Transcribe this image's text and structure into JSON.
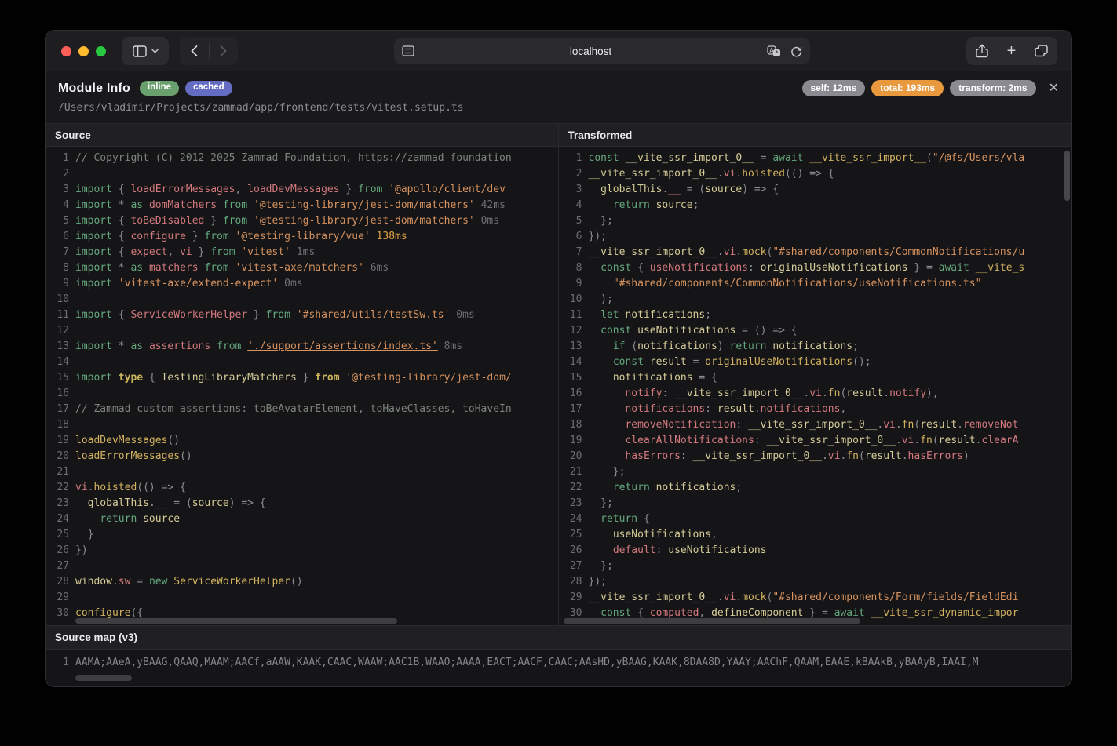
{
  "browser": {
    "url": "localhost",
    "traffic_lights": {
      "close": "#ff5f57",
      "minimize": "#febc2e",
      "zoom": "#28c840"
    }
  },
  "icons": {
    "plus": "+",
    "close": "✕"
  },
  "header": {
    "title": "Module Info",
    "badges": [
      {
        "label": "inline",
        "color": "#6aa06d"
      },
      {
        "label": "cached",
        "color": "#646cc3"
      }
    ],
    "path": "/Users/vladimir/Projects/zammad/app/frontend/tests/vitest.setup.ts",
    "timings": [
      {
        "label": "self: 12ms",
        "color": "#8a8a90"
      },
      {
        "label": "total: 193ms",
        "color": "#e8993e"
      },
      {
        "label": "transform: 2ms",
        "color": "#8a8a90"
      }
    ]
  },
  "syntax_colors": {
    "comment": "#7c847c",
    "keyword": "#64a87e",
    "identifier": "#d3797e",
    "string": "#d6925f",
    "function": "#d2b160",
    "variable": "#d6cc98",
    "punctuation": "#8e8e93",
    "timing": "#6f6f75",
    "timing_slow": "#e0a345"
  },
  "panels": {
    "source": {
      "title": "Source",
      "lines": [
        [
          [
            "c",
            "// Copyright (C) 2012-2025 Zammad Foundation, https://zammad-foundation"
          ]
        ],
        [],
        [
          [
            "k",
            "import "
          ],
          [
            "p",
            "{ "
          ],
          [
            "i",
            "loadErrorMessages"
          ],
          [
            "p",
            ", "
          ],
          [
            "i",
            "loadDevMessages"
          ],
          [
            "p",
            " } "
          ],
          [
            "k",
            "from "
          ],
          [
            "s",
            "'@apollo/client/dev"
          ]
        ],
        [
          [
            "k",
            "import "
          ],
          [
            "p",
            "* "
          ],
          [
            "k",
            "as "
          ],
          [
            "i",
            "domMatchers"
          ],
          [
            "k",
            " from "
          ],
          [
            "s",
            "'@testing-library/jest-dom/matchers'"
          ],
          [
            "t",
            " 42ms"
          ]
        ],
        [
          [
            "k",
            "import "
          ],
          [
            "p",
            "{ "
          ],
          [
            "i",
            "toBeDisabled"
          ],
          [
            "p",
            " } "
          ],
          [
            "k",
            "from "
          ],
          [
            "s",
            "'@testing-library/jest-dom/matchers'"
          ],
          [
            "t",
            " 0ms"
          ]
        ],
        [
          [
            "k",
            "import "
          ],
          [
            "p",
            "{ "
          ],
          [
            "i",
            "configure"
          ],
          [
            "p",
            " } "
          ],
          [
            "k",
            "from "
          ],
          [
            "s",
            "'@testing-library/vue'"
          ],
          [
            "th",
            " 138ms"
          ]
        ],
        [
          [
            "k",
            "import "
          ],
          [
            "p",
            "{ "
          ],
          [
            "i",
            "expect"
          ],
          [
            "p",
            ", "
          ],
          [
            "i",
            "vi"
          ],
          [
            "p",
            " } "
          ],
          [
            "k",
            "from "
          ],
          [
            "s",
            "'vitest'"
          ],
          [
            "t",
            " 1ms"
          ]
        ],
        [
          [
            "k",
            "import "
          ],
          [
            "p",
            "* "
          ],
          [
            "k",
            "as "
          ],
          [
            "i",
            "matchers"
          ],
          [
            "k",
            " from "
          ],
          [
            "s",
            "'vitest-axe/matchers'"
          ],
          [
            "t",
            " 6ms"
          ]
        ],
        [
          [
            "k",
            "import "
          ],
          [
            "s",
            "'vitest-axe/extend-expect'"
          ],
          [
            "t",
            " 0ms"
          ]
        ],
        [],
        [
          [
            "k",
            "import "
          ],
          [
            "p",
            "{ "
          ],
          [
            "i",
            "ServiceWorkerHelper"
          ],
          [
            "p",
            " } "
          ],
          [
            "k",
            "from "
          ],
          [
            "s",
            "'#shared/utils/testSw.ts'"
          ],
          [
            "t",
            " 0ms"
          ]
        ],
        [],
        [
          [
            "k",
            "import "
          ],
          [
            "p",
            "* "
          ],
          [
            "k",
            "as "
          ],
          [
            "i",
            "assertions"
          ],
          [
            "k",
            " from "
          ],
          [
            "l",
            "'./support/assertions/index.ts'"
          ],
          [
            "t",
            " 8ms"
          ]
        ],
        [],
        [
          [
            "k",
            "import "
          ],
          [
            "ty",
            "type "
          ],
          [
            "p",
            "{ "
          ],
          [
            "v",
            "TestingLibraryMatchers"
          ],
          [
            "p",
            " } "
          ],
          [
            "ty",
            "from "
          ],
          [
            "s",
            "'@testing-library/jest-dom/"
          ]
        ],
        [],
        [
          [
            "c",
            "// Zammad custom assertions: toBeAvatarElement, toHaveClasses, toHaveIn"
          ]
        ],
        [],
        [
          [
            "f",
            "loadDevMessages"
          ],
          [
            "p",
            "()"
          ]
        ],
        [
          [
            "f",
            "loadErrorMessages"
          ],
          [
            "p",
            "()"
          ]
        ],
        [],
        [
          [
            "i",
            "vi"
          ],
          [
            "p",
            "."
          ],
          [
            "f",
            "hoisted"
          ],
          [
            "p",
            "(() => {"
          ]
        ],
        [
          [
            "p",
            "  "
          ],
          [
            "v",
            "globalThis"
          ],
          [
            "p",
            "."
          ],
          [
            "i",
            "__"
          ],
          [
            "p",
            " = ("
          ],
          [
            "v",
            "source"
          ],
          [
            "p",
            ") => {"
          ]
        ],
        [
          [
            "p",
            "    "
          ],
          [
            "k",
            "return "
          ],
          [
            "v",
            "source"
          ]
        ],
        [
          [
            "p",
            "  }"
          ]
        ],
        [
          [
            "p",
            "})"
          ]
        ],
        [],
        [
          [
            "v",
            "window"
          ],
          [
            "p",
            "."
          ],
          [
            "i",
            "sw"
          ],
          [
            "p",
            " = "
          ],
          [
            "k",
            "new "
          ],
          [
            "f",
            "ServiceWorkerHelper"
          ],
          [
            "p",
            "()"
          ]
        ],
        [],
        [
          [
            "f",
            "configure"
          ],
          [
            "p",
            "({"
          ]
        ]
      ]
    },
    "transformed": {
      "title": "Transformed",
      "lines": [
        [
          [
            "k",
            "const "
          ],
          [
            "v",
            "__vite_ssr_import_0__"
          ],
          [
            "p",
            " = "
          ],
          [
            "k",
            "await "
          ],
          [
            "f",
            "__vite_ssr_import__"
          ],
          [
            "p",
            "("
          ],
          [
            "s",
            "\"/@fs/Users/vla"
          ]
        ],
        [
          [
            "v",
            "__vite_ssr_import_0__"
          ],
          [
            "p",
            "."
          ],
          [
            "i",
            "vi"
          ],
          [
            "p",
            "."
          ],
          [
            "f",
            "hoisted"
          ],
          [
            "p",
            "(() => {"
          ]
        ],
        [
          [
            "p",
            "  "
          ],
          [
            "v",
            "globalThis"
          ],
          [
            "p",
            "."
          ],
          [
            "i",
            "__"
          ],
          [
            "p",
            " = ("
          ],
          [
            "v",
            "source"
          ],
          [
            "p",
            ") => {"
          ]
        ],
        [
          [
            "p",
            "    "
          ],
          [
            "k",
            "return "
          ],
          [
            "v",
            "source"
          ],
          [
            "p",
            ";"
          ]
        ],
        [
          [
            "p",
            "  };"
          ]
        ],
        [
          [
            "p",
            "});"
          ]
        ],
        [
          [
            "v",
            "__vite_ssr_import_0__"
          ],
          [
            "p",
            "."
          ],
          [
            "i",
            "vi"
          ],
          [
            "p",
            "."
          ],
          [
            "f",
            "mock"
          ],
          [
            "p",
            "("
          ],
          [
            "s",
            "\"#shared/components/CommonNotifications/u"
          ]
        ],
        [
          [
            "p",
            "  "
          ],
          [
            "k",
            "const "
          ],
          [
            "p",
            "{ "
          ],
          [
            "i",
            "useNotifications"
          ],
          [
            "p",
            ": "
          ],
          [
            "v",
            "originalUseNotifications"
          ],
          [
            "p",
            " } = "
          ],
          [
            "k",
            "await "
          ],
          [
            "f",
            "__vite_s"
          ]
        ],
        [
          [
            "p",
            "    "
          ],
          [
            "s",
            "\"#shared/components/CommonNotifications/useNotifications.ts\""
          ]
        ],
        [
          [
            "p",
            "  );"
          ]
        ],
        [
          [
            "p",
            "  "
          ],
          [
            "k",
            "let "
          ],
          [
            "v",
            "notifications"
          ],
          [
            "p",
            ";"
          ]
        ],
        [
          [
            "p",
            "  "
          ],
          [
            "k",
            "const "
          ],
          [
            "v",
            "useNotifications"
          ],
          [
            "p",
            " = () => {"
          ]
        ],
        [
          [
            "p",
            "    "
          ],
          [
            "k",
            "if "
          ],
          [
            "p",
            "("
          ],
          [
            "v",
            "notifications"
          ],
          [
            "p",
            ") "
          ],
          [
            "k",
            "return "
          ],
          [
            "v",
            "notifications"
          ],
          [
            "p",
            ";"
          ]
        ],
        [
          [
            "p",
            "    "
          ],
          [
            "k",
            "const "
          ],
          [
            "v",
            "result"
          ],
          [
            "p",
            " = "
          ],
          [
            "f",
            "originalUseNotifications"
          ],
          [
            "p",
            "();"
          ]
        ],
        [
          [
            "p",
            "    "
          ],
          [
            "v",
            "notifications"
          ],
          [
            "p",
            " = {"
          ]
        ],
        [
          [
            "p",
            "      "
          ],
          [
            "i",
            "notify"
          ],
          [
            "p",
            ": "
          ],
          [
            "v",
            "__vite_ssr_import_0__"
          ],
          [
            "p",
            "."
          ],
          [
            "i",
            "vi"
          ],
          [
            "p",
            "."
          ],
          [
            "f",
            "fn"
          ],
          [
            "p",
            "("
          ],
          [
            "v",
            "result"
          ],
          [
            "p",
            "."
          ],
          [
            "i",
            "notify"
          ],
          [
            "p",
            "),"
          ]
        ],
        [
          [
            "p",
            "      "
          ],
          [
            "i",
            "notifications"
          ],
          [
            "p",
            ": "
          ],
          [
            "v",
            "result"
          ],
          [
            "p",
            "."
          ],
          [
            "i",
            "notifications"
          ],
          [
            "p",
            ","
          ]
        ],
        [
          [
            "p",
            "      "
          ],
          [
            "i",
            "removeNotification"
          ],
          [
            "p",
            ": "
          ],
          [
            "v",
            "__vite_ssr_import_0__"
          ],
          [
            "p",
            "."
          ],
          [
            "i",
            "vi"
          ],
          [
            "p",
            "."
          ],
          [
            "f",
            "fn"
          ],
          [
            "p",
            "("
          ],
          [
            "v",
            "result"
          ],
          [
            "p",
            "."
          ],
          [
            "i",
            "removeNot"
          ]
        ],
        [
          [
            "p",
            "      "
          ],
          [
            "i",
            "clearAllNotifications"
          ],
          [
            "p",
            ": "
          ],
          [
            "v",
            "__vite_ssr_import_0__"
          ],
          [
            "p",
            "."
          ],
          [
            "i",
            "vi"
          ],
          [
            "p",
            "."
          ],
          [
            "f",
            "fn"
          ],
          [
            "p",
            "("
          ],
          [
            "v",
            "result"
          ],
          [
            "p",
            "."
          ],
          [
            "i",
            "clearA"
          ]
        ],
        [
          [
            "p",
            "      "
          ],
          [
            "i",
            "hasErrors"
          ],
          [
            "p",
            ": "
          ],
          [
            "v",
            "__vite_ssr_import_0__"
          ],
          [
            "p",
            "."
          ],
          [
            "i",
            "vi"
          ],
          [
            "p",
            "."
          ],
          [
            "f",
            "fn"
          ],
          [
            "p",
            "("
          ],
          [
            "v",
            "result"
          ],
          [
            "p",
            "."
          ],
          [
            "i",
            "hasErrors"
          ],
          [
            "p",
            ")"
          ]
        ],
        [
          [
            "p",
            "    };"
          ]
        ],
        [
          [
            "p",
            "    "
          ],
          [
            "k",
            "return "
          ],
          [
            "v",
            "notifications"
          ],
          [
            "p",
            ";"
          ]
        ],
        [
          [
            "p",
            "  };"
          ]
        ],
        [
          [
            "p",
            "  "
          ],
          [
            "k",
            "return"
          ],
          [
            "p",
            " {"
          ]
        ],
        [
          [
            "p",
            "    "
          ],
          [
            "v",
            "useNotifications"
          ],
          [
            "p",
            ","
          ]
        ],
        [
          [
            "p",
            "    "
          ],
          [
            "i",
            "default"
          ],
          [
            "p",
            ": "
          ],
          [
            "v",
            "useNotifications"
          ]
        ],
        [
          [
            "p",
            "  };"
          ]
        ],
        [
          [
            "p",
            "});"
          ]
        ],
        [
          [
            "v",
            "__vite_ssr_import_0__"
          ],
          [
            "p",
            "."
          ],
          [
            "i",
            "vi"
          ],
          [
            "p",
            "."
          ],
          [
            "f",
            "mock"
          ],
          [
            "p",
            "("
          ],
          [
            "s",
            "\"#shared/components/Form/fields/FieldEdi"
          ]
        ],
        [
          [
            "p",
            "  "
          ],
          [
            "k",
            "const "
          ],
          [
            "p",
            "{ "
          ],
          [
            "i",
            "computed"
          ],
          [
            "p",
            ", "
          ],
          [
            "v",
            "defineComponent"
          ],
          [
            "p",
            " } = "
          ],
          [
            "k",
            "await "
          ],
          [
            "f",
            "__vite_ssr_dynamic_impor"
          ]
        ]
      ]
    }
  },
  "sourcemap": {
    "title": "Source map (v3)",
    "line_number": "1",
    "mappings": "AAMA;AAeA,yBAAG,QAAQ,MAAM;AACf,aAAW,KAAK,CAAC,WAAW;AAC1B,WAAO;AAAA,EACT;AACF,CAAC;AAsHD,yBAAG,KAAK,8DAA8D,YAAY;AAChF,QAAM,EAAE,kBAAkB,yBAAyB,IAAI,M"
  }
}
